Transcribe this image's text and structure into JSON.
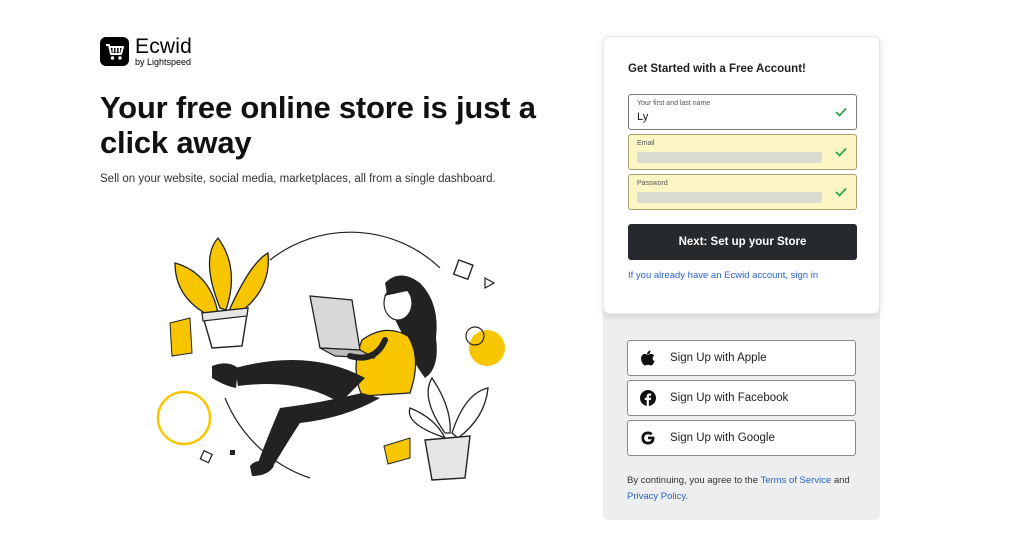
{
  "brand": {
    "name": "Ecwid",
    "tagline": "by Lightspeed"
  },
  "hero": {
    "title": "Your free online store is just a click away",
    "subtitle": "Sell on your website, social media, marketplaces, all from a single dashboard."
  },
  "form": {
    "title": "Get Started with a Free Account!",
    "name": {
      "label": "Your first and last name",
      "value": "Ly"
    },
    "email": {
      "label": "Email",
      "value": ""
    },
    "password": {
      "label": "Password",
      "value": ""
    },
    "submit_label": "Next: Set up your Store",
    "signin_text": "If you already have an Ecwid account, sign in"
  },
  "social": {
    "apple": "Sign Up with Apple",
    "facebook": "Sign Up with Facebook",
    "google": "Sign Up with Google"
  },
  "terms": {
    "prefix": "By continuing, you agree to the ",
    "tos": "Terms of Service",
    "and": " and",
    "privacy": "Privacy Policy",
    "suffix": "."
  },
  "colors": {
    "accent_yellow": "#f7c600",
    "primary_button": "#26292d",
    "link": "#2c64c5",
    "check_green": "#2ea44f",
    "autofill": "#fbf6c4"
  },
  "icons": {
    "logo": "shopping-cart-icon",
    "check": "checkmark-icon",
    "apple": "apple-icon",
    "facebook": "facebook-icon",
    "google": "google-icon"
  }
}
